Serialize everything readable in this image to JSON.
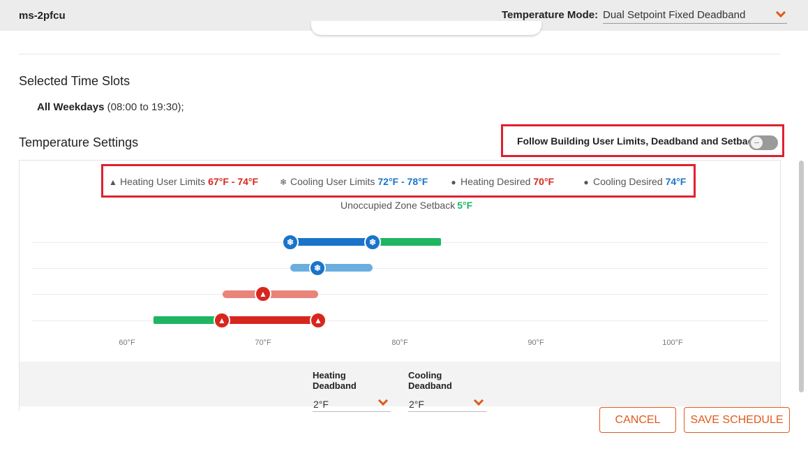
{
  "header": {
    "device_name": "ms-2pfcu",
    "mode_label": "Temperature Mode:",
    "mode_value": "Dual Setpoint Fixed Deadband"
  },
  "selected_slots": {
    "title": "Selected Time Slots",
    "day": "All Weekdays",
    "time": "(08:00 to 19:30);"
  },
  "temperature_settings": {
    "title": "Temperature Settings",
    "follow_label": "Follow Building User Limits, Deadband and Setback",
    "follow_enabled": false
  },
  "legend": {
    "heating_limits_label": "Heating User Limits",
    "heating_limits_value": "67°F - 74°F",
    "cooling_limits_label": "Cooling User Limits",
    "cooling_limits_value": "72°F - 78°F",
    "heating_desired_label": "Heating Desired",
    "heating_desired_value": "70°F",
    "cooling_desired_label": "Cooling Desired",
    "cooling_desired_value": "74°F",
    "setback_label": "Unoccupied Zone Setback",
    "setback_value": "5°F"
  },
  "scale": {
    "ticks": [
      "60°F",
      "70°F",
      "80°F",
      "90°F",
      "100°F"
    ]
  },
  "deadband": {
    "heating_label": "Heating Deadband",
    "heating_value": "2°F",
    "cooling_label": "Cooling Deadband",
    "cooling_value": "2°F"
  },
  "actions": {
    "cancel": "CANCEL",
    "save": "SAVE SCHEDULE"
  },
  "colors": {
    "accent": "#e05a1e",
    "heat": "#d7261e",
    "heat_light": "#e8847a",
    "cool": "#1a74c9",
    "cool_light": "#6aaee0",
    "setback": "#1fb563",
    "highlight": "#e0202e"
  }
}
